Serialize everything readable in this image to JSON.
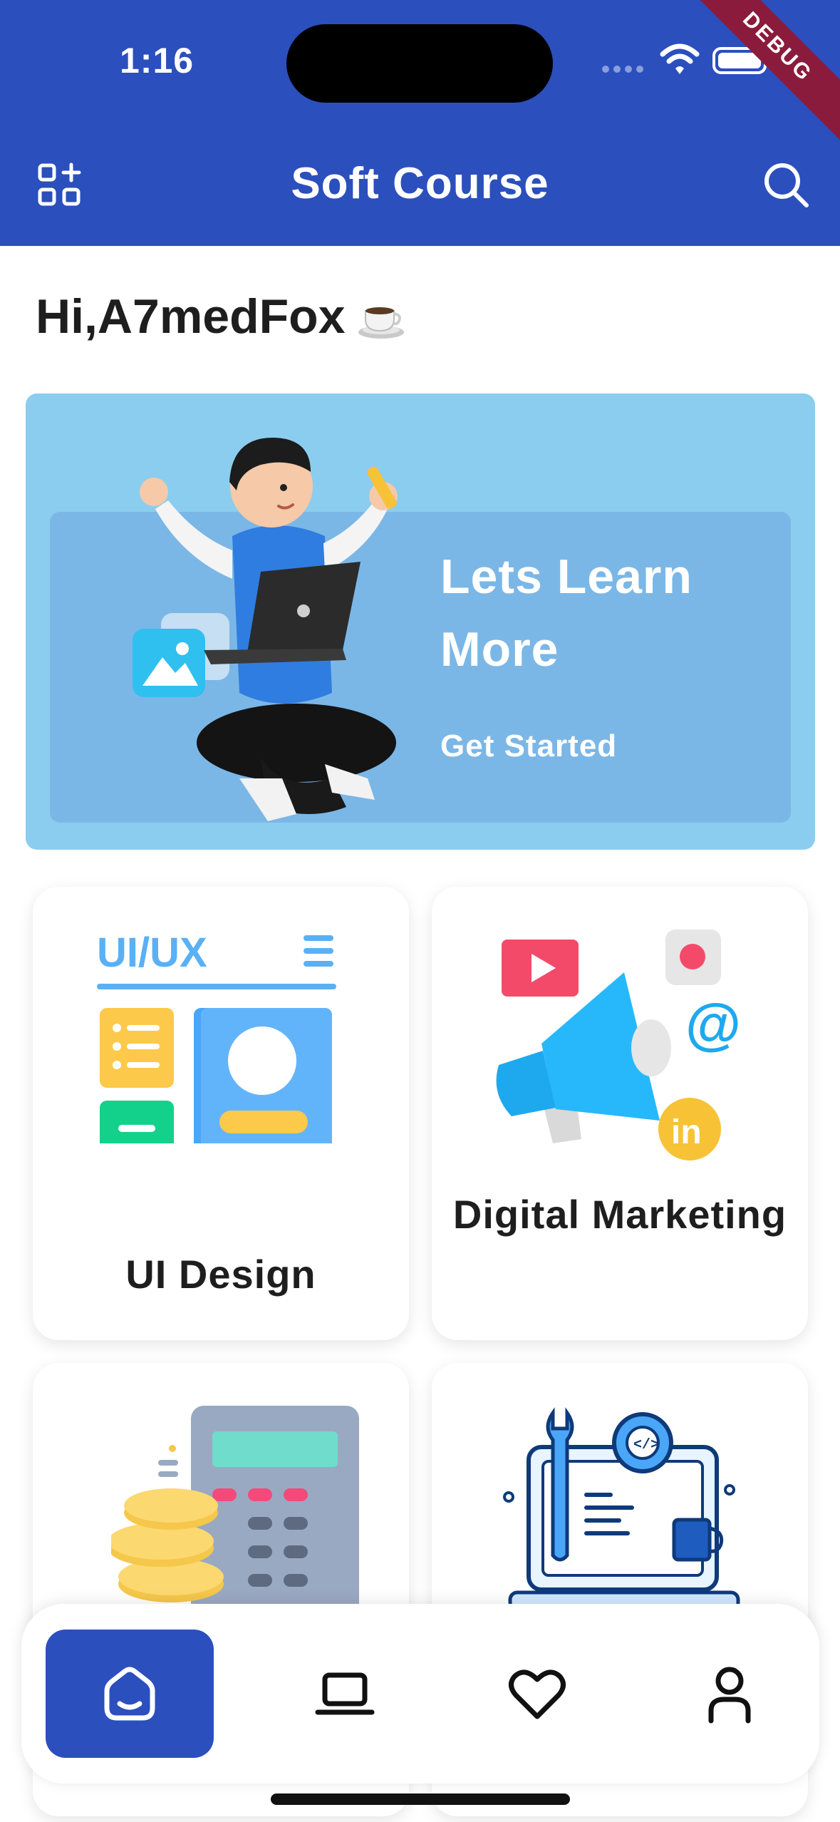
{
  "status_bar": {
    "time": "1:16",
    "debug_label": "DEBUG"
  },
  "app_bar": {
    "title": "Soft Course",
    "left_icon": "grid-add-icon",
    "right_icon": "search-icon",
    "background_color": "#2b4fbd"
  },
  "greeting": {
    "text": "Hi,A7medFox",
    "emoji": "coffee-cup-icon"
  },
  "banner": {
    "title": "Lets Learn More",
    "cta": "Get Started",
    "background_color": "#8bcdee",
    "inner_color": "#7bb7e6"
  },
  "courses": [
    {
      "label": "UI Design",
      "art": "ui-ux-illustration",
      "art_text": "UI/UX"
    },
    {
      "label": "Digital Marketing",
      "art": "megaphone-illustration"
    },
    {
      "label": "",
      "art": "calculator-coins-illustration"
    },
    {
      "label": "",
      "art": "developer-tools-illustration"
    }
  ],
  "bottom_nav": [
    {
      "name": "home",
      "icon": "home-icon",
      "active": true
    },
    {
      "name": "courses",
      "icon": "laptop-icon",
      "active": false
    },
    {
      "name": "favorites",
      "icon": "heart-icon",
      "active": false
    },
    {
      "name": "profile",
      "icon": "user-icon",
      "active": false
    }
  ]
}
